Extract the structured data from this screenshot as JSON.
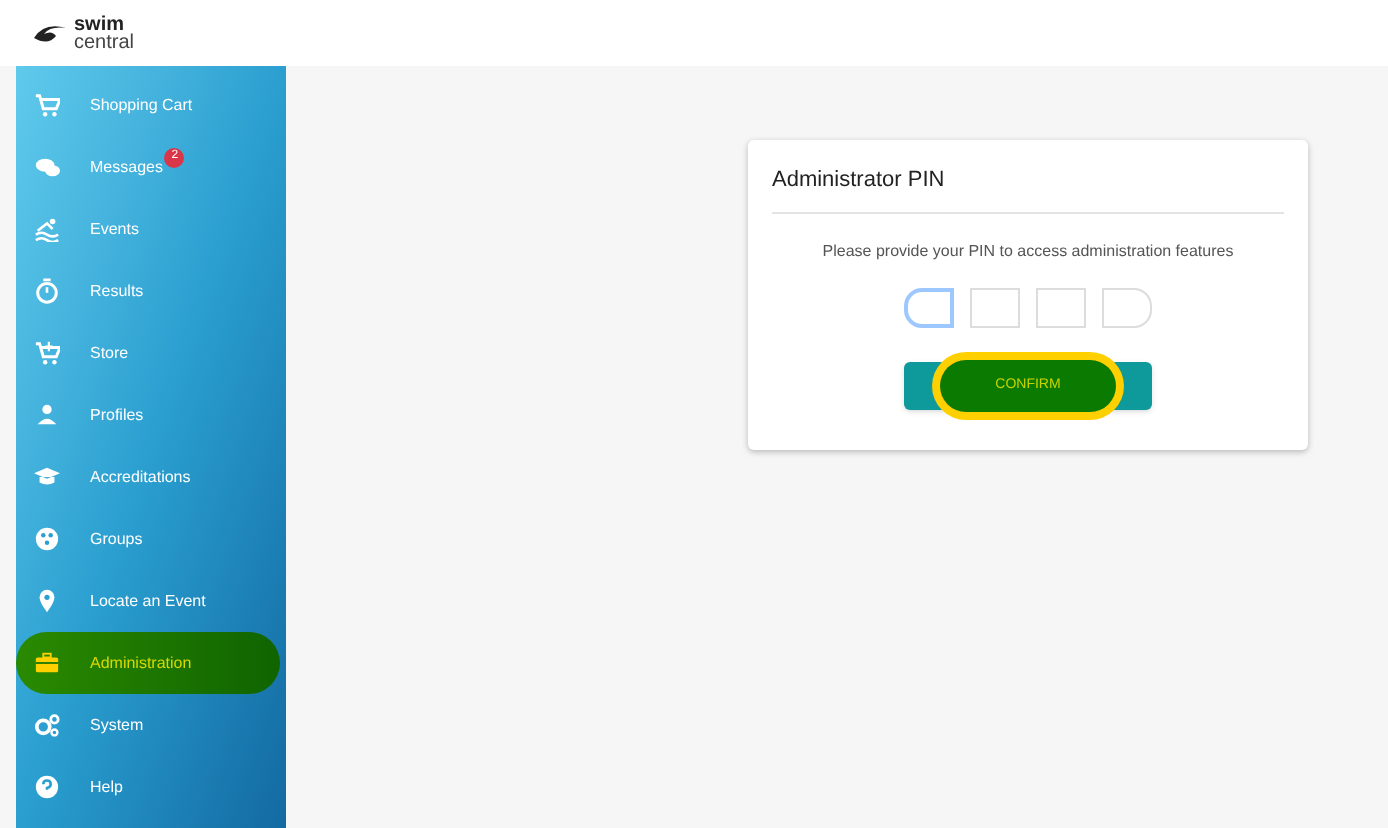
{
  "header": {
    "logo_top": "swim",
    "logo_bottom": "central"
  },
  "sidebar": {
    "items": [
      {
        "label": "Shopping Cart",
        "selected": false
      },
      {
        "label": "Messages",
        "selected": false,
        "badge": "2"
      },
      {
        "label": "Events",
        "selected": false
      },
      {
        "label": "Results",
        "selected": false
      },
      {
        "label": "Store",
        "selected": false
      },
      {
        "label": "Profiles",
        "selected": false
      },
      {
        "label": "Accreditations",
        "selected": false
      },
      {
        "label": "Groups",
        "selected": false
      },
      {
        "label": "Locate an Event",
        "selected": false
      },
      {
        "label": "Administration",
        "selected": true
      },
      {
        "label": "System",
        "selected": false
      },
      {
        "label": "Help",
        "selected": false
      }
    ]
  },
  "dialog": {
    "title": "Administrator PIN",
    "message": "Please provide your PIN to access administration features",
    "pin_boxes": [
      {
        "focused": true
      },
      {
        "focused": false
      },
      {
        "focused": false
      },
      {
        "focused": false
      }
    ],
    "confirm_button": {
      "label": "CONFIRM",
      "highlighted": true
    }
  }
}
